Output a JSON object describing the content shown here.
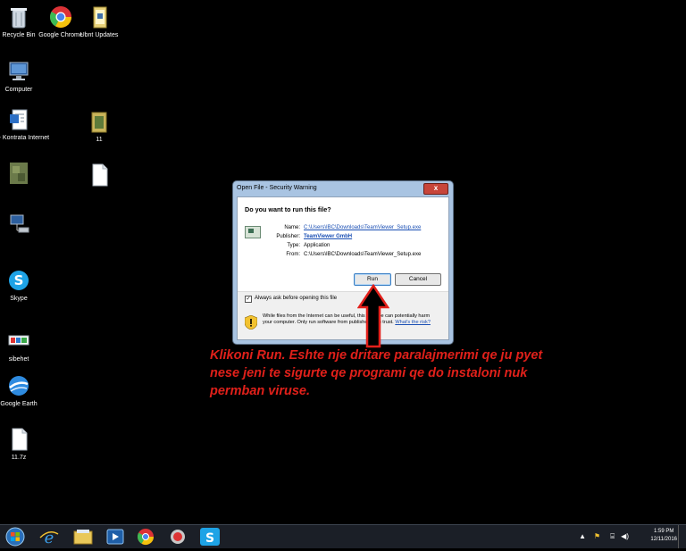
{
  "desktop": {
    "icons": [
      {
        "label": "Recycle Bin",
        "icon": "recycle-bin-icon"
      },
      {
        "label": "Google Chrome",
        "icon": "chrome-icon"
      },
      {
        "label": "Ubnt Updates",
        "icon": "folder-icon"
      },
      {
        "label": "Computer",
        "icon": "computer-icon"
      },
      {
        "label": "IBC- Kontrata Internet",
        "icon": "document-icon"
      },
      {
        "label": "11",
        "icon": "folder-icon"
      },
      {
        "label": "",
        "icon": "image-icon"
      },
      {
        "label": "",
        "icon": "file-icon"
      },
      {
        "label": "",
        "icon": "network-icon"
      },
      {
        "label": "Skype",
        "icon": "skype-icon"
      },
      {
        "label": "sibehet",
        "icon": "shortcut-icon"
      },
      {
        "label": "Google Earth",
        "icon": "google-earth-icon"
      },
      {
        "label": "11.7z",
        "icon": "file-icon"
      }
    ]
  },
  "dialog": {
    "title": "Open File - Security Warning",
    "close_label": "x",
    "question": "Do you want to run this file?",
    "fields": {
      "name_label": "Name:",
      "name_value": "C:\\Users\\IBC\\Downloads\\TeamViewer_Setup.exe",
      "publisher_label": "Publisher:",
      "publisher_value": "TeamViewer GmbH",
      "type_label": "Type:",
      "type_value": "Application",
      "from_label": "From:",
      "from_value": "C:\\Users\\IBC\\Downloads\\TeamViewer_Setup.exe"
    },
    "run_label": "Run",
    "cancel_label": "Cancel",
    "checkbox_label": "Always ask before opening this file",
    "checkbox_checked": true,
    "warning_text": "While files from the Internet can be useful, this file type can potentially harm your computer. Only run software from publishers you trust.",
    "risk_link": "What's the risk?"
  },
  "annotation": {
    "text": "Klikoni Run. Eshte nje dritare paralajmerimi qe ju pyet nese jeni te sigurte qe programi qe do instaloni nuk permban viruse.",
    "color": "#e0201a"
  },
  "taskbar": {
    "items": [
      "start-button",
      "internet-explorer",
      "file-explorer",
      "media-player",
      "chrome",
      "app",
      "skype"
    ],
    "time": "1:59 PM",
    "date": "12/11/2016"
  }
}
